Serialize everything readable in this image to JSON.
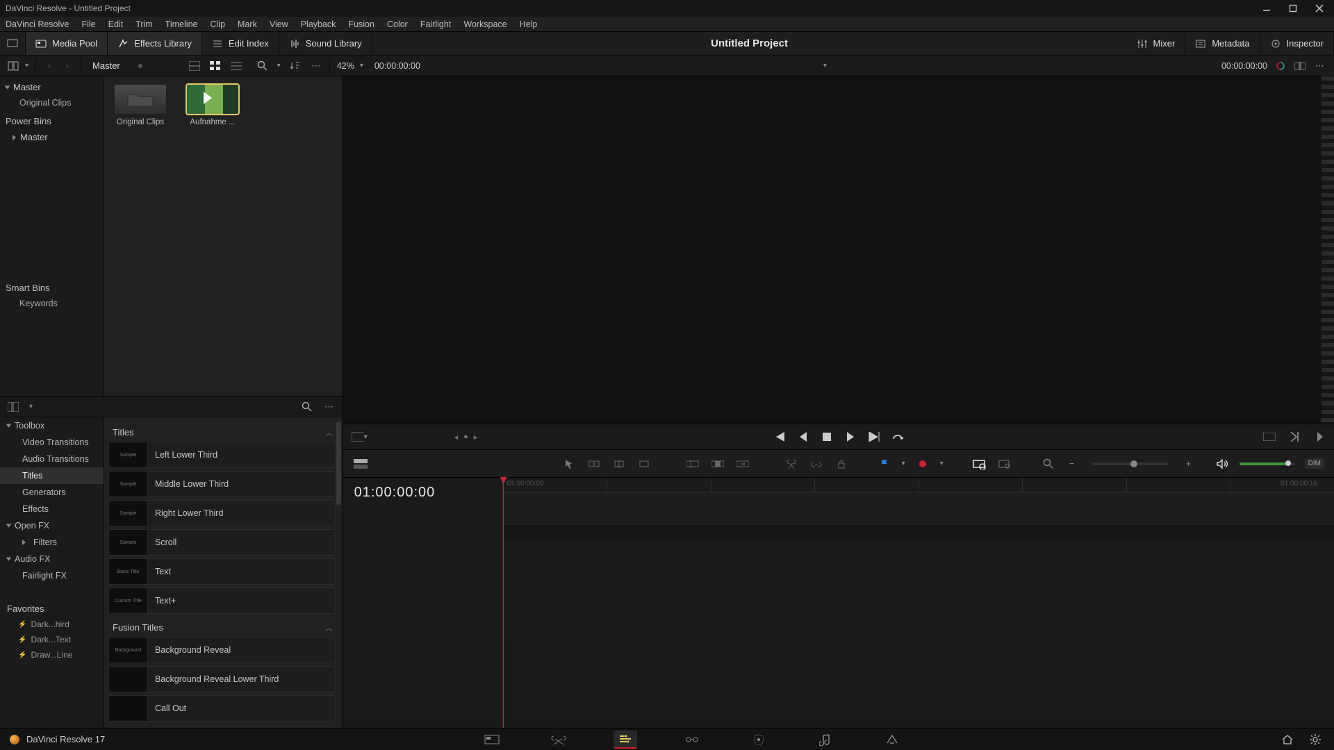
{
  "titlebar": {
    "text": "DaVinci Resolve - Untitled Project"
  },
  "menubar": [
    "DaVinci Resolve",
    "File",
    "Edit",
    "Trim",
    "Timeline",
    "Clip",
    "Mark",
    "View",
    "Playback",
    "Fusion",
    "Color",
    "Fairlight",
    "Workspace",
    "Help"
  ],
  "toolbar": {
    "media_pool": "Media Pool",
    "effects_library": "Effects Library",
    "edit_index": "Edit Index",
    "sound_library": "Sound Library",
    "mixer": "Mixer",
    "metadata": "Metadata",
    "inspector": "Inspector",
    "project_title": "Untitled Project"
  },
  "subtoolbar": {
    "bin_path": "Master",
    "fit_pct": "42%",
    "source_tc": "00:00:00:00",
    "record_tc": "00:00:00:00"
  },
  "bins": {
    "master": "Master",
    "original_clips": "Original Clips",
    "power_bins": "Power Bins",
    "power_master": "Master",
    "smart_bins": "Smart Bins",
    "keywords": "Keywords"
  },
  "thumbs": {
    "folder_label": "Original Clips",
    "clip_label": "Aufnahme ..."
  },
  "fx": {
    "toolbox": "Toolbox",
    "video_transitions": "Video Transitions",
    "audio_transitions": "Audio Transitions",
    "titles": "Titles",
    "generators": "Generators",
    "effects": "Effects",
    "open_fx": "Open FX",
    "filters": "Filters",
    "audio_fx": "Audio FX",
    "fairlight_fx": "Fairlight FX",
    "favorites": "Favorites",
    "fav1": "Dark...hird",
    "fav2": "Dark...Text",
    "fav3": "Draw...Line",
    "group_titles": "Titles",
    "group_fusion": "Fusion Titles",
    "items_titles": [
      {
        "thumb": "Sample",
        "label": "Left Lower Third"
      },
      {
        "thumb": "Sample",
        "label": "Middle Lower Third"
      },
      {
        "thumb": "Sample",
        "label": "Right Lower Third"
      },
      {
        "thumb": "Sample",
        "label": "Scroll"
      },
      {
        "thumb": "Basic Title",
        "label": "Text"
      },
      {
        "thumb": "Custom Title",
        "label": "Text+"
      }
    ],
    "items_fusion": [
      {
        "thumb": "Background",
        "label": "Background Reveal"
      },
      {
        "thumb": "",
        "label": "Background Reveal Lower Third"
      },
      {
        "thumb": "",
        "label": "Call Out"
      }
    ]
  },
  "timeline": {
    "tc": "01:00:00:00",
    "ruler_start": "01:00:00:00",
    "ruler_end": "01:00:00:16"
  },
  "tl_toolbar": {
    "dim": "DIM"
  },
  "bottombar": {
    "label": "DaVinci Resolve 17"
  }
}
